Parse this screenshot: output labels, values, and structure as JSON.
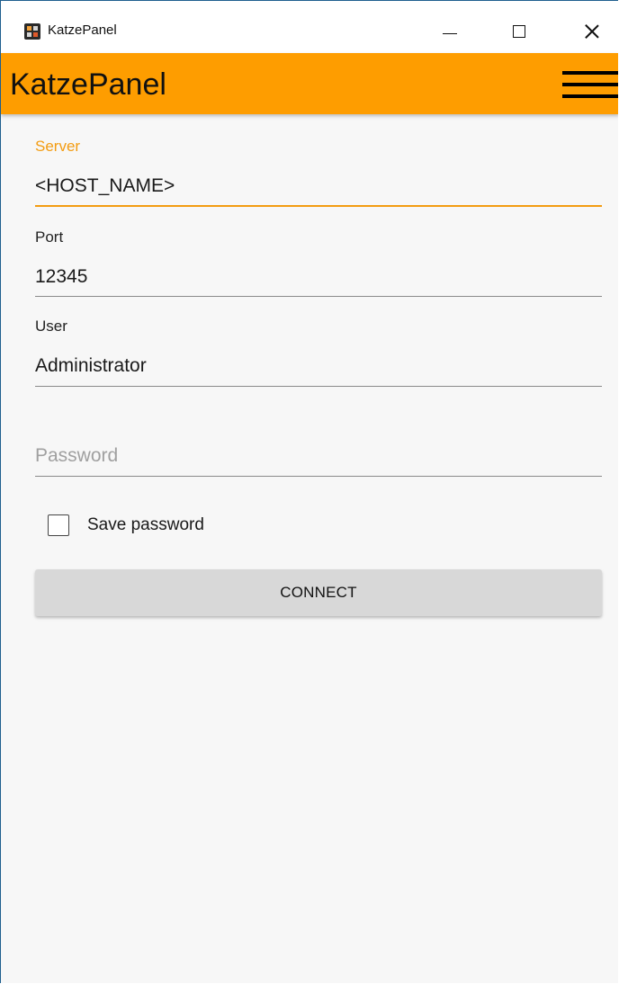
{
  "window": {
    "title": "KatzePanel",
    "icon": "app-icon",
    "controls": [
      "minimize-icon",
      "maximize-icon",
      "close-icon"
    ]
  },
  "appbar": {
    "title": "KatzePanel",
    "menu_icon": "hamburger-menu-icon",
    "color": "#fe9d00"
  },
  "form": {
    "server": {
      "label": "Server",
      "value": "<HOST_NAME>"
    },
    "port": {
      "label": "Port",
      "value": "12345"
    },
    "user": {
      "label": "User",
      "value": "Administrator"
    },
    "password": {
      "placeholder": "Password",
      "value": ""
    },
    "save_password": {
      "label": "Save password",
      "checked": false
    },
    "connect_label": "CONNECT"
  },
  "colors": {
    "accent": "#f39c12",
    "button_bg": "#d8d8d8"
  }
}
